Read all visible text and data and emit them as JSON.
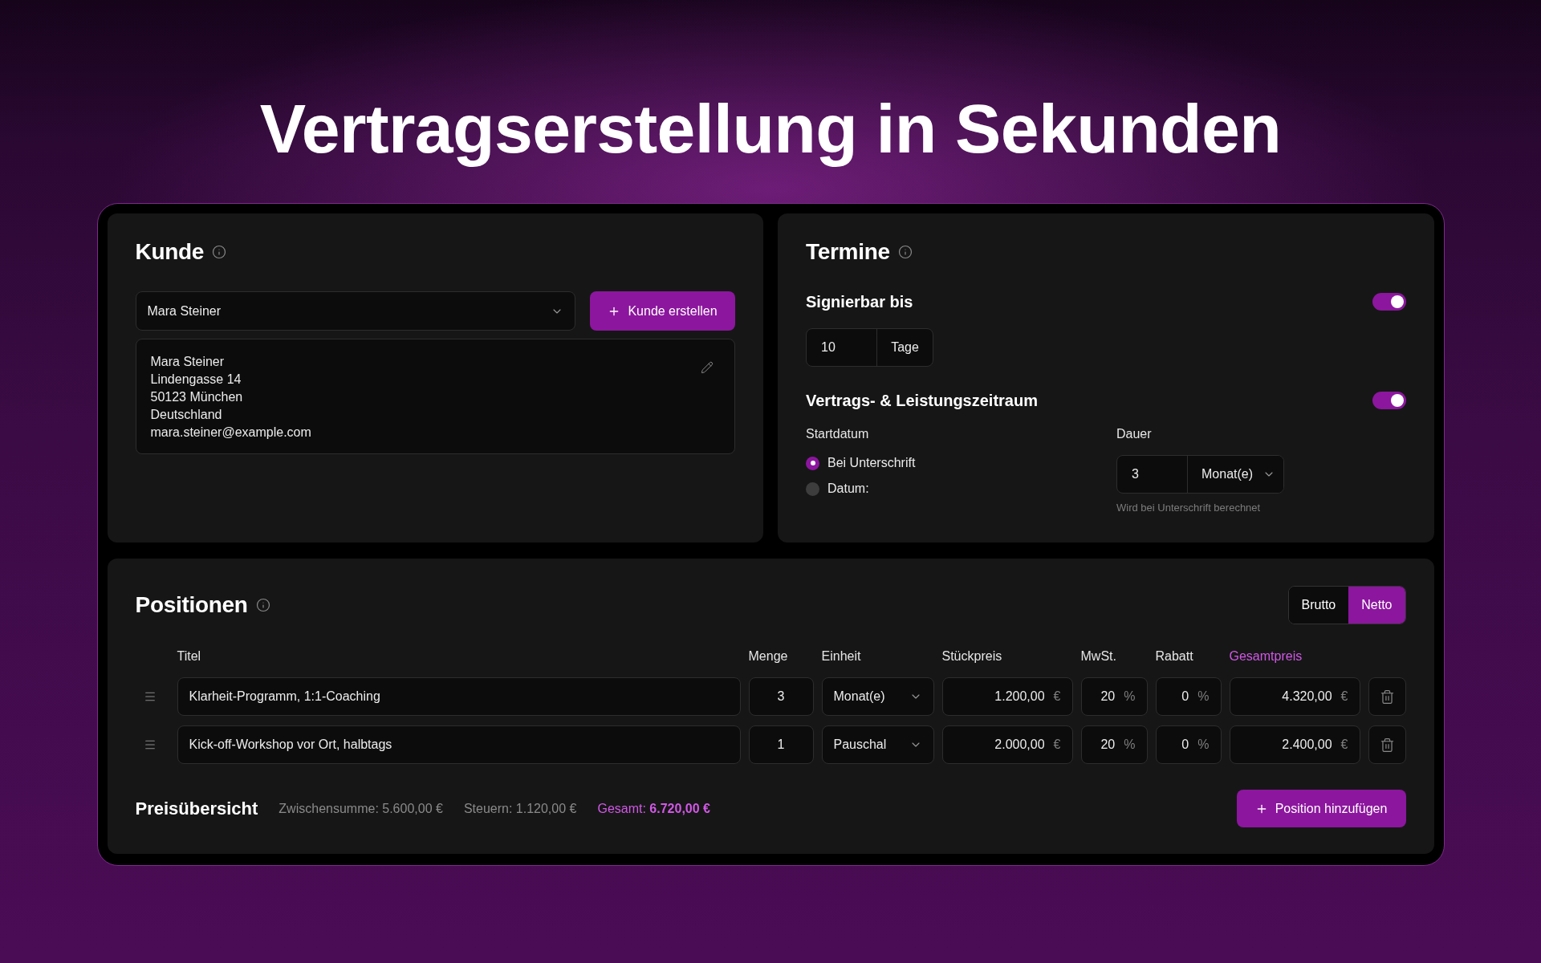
{
  "headline": "Vertragserstellung in Sekunden",
  "customer": {
    "title": "Kunde",
    "select": {
      "value": "Mara Steiner"
    },
    "create_button": "Kunde erstellen",
    "address_lines": [
      "Mara Steiner",
      "Lindengasse 14",
      "50123 München",
      "Deutschland",
      "mara.steiner@example.com"
    ]
  },
  "schedule": {
    "title": "Termine",
    "signable": {
      "label": "Signierbar bis",
      "on": true,
      "value": "10",
      "unit": "Tage"
    },
    "period": {
      "label": "Vertrags- & Leistungszeitraum",
      "on": true,
      "start_label": "Startdatum",
      "start_options": [
        {
          "label": "Bei Unterschrift",
          "selected": true
        },
        {
          "label": "Datum:",
          "selected": false
        }
      ],
      "duration_label": "Dauer",
      "duration_value": "3",
      "duration_unit": "Monat(e)",
      "hint": "Wird bei Unterschrift berechnet"
    }
  },
  "positions": {
    "title": "Positionen",
    "price_modes": [
      {
        "label": "Brutto",
        "selected": false
      },
      {
        "label": "Netto",
        "selected": true
      }
    ],
    "columns": [
      {
        "label": "Titel",
        "highlighted": false
      },
      {
        "label": "Menge",
        "highlighted": false
      },
      {
        "label": "Einheit",
        "highlighted": false
      },
      {
        "label": "Stückpreis",
        "highlighted": false
      },
      {
        "label": "MwSt.",
        "highlighted": false
      },
      {
        "label": "Rabatt",
        "highlighted": false
      },
      {
        "label": "Gesamtpreis",
        "highlighted": true
      }
    ],
    "rows": [
      {
        "title": "Klarheit-Programm, 1:1-Coaching",
        "quantity": "3",
        "unit": "Monat(e)",
        "unit_price": {
          "value": "1.200,00",
          "suffix": "€"
        },
        "vat": {
          "value": "20",
          "suffix": "%"
        },
        "discount": {
          "value": "0",
          "suffix": "%"
        },
        "total": {
          "value": "4.320,00",
          "suffix": "€"
        }
      },
      {
        "title": "Kick-off-Workshop vor Ort, halbtags",
        "quantity": "1",
        "unit": "Pauschal",
        "unit_price": {
          "value": "2.000,00",
          "suffix": "€"
        },
        "vat": {
          "value": "20",
          "suffix": "%"
        },
        "discount": {
          "value": "0",
          "suffix": "%"
        },
        "total": {
          "value": "2.400,00",
          "suffix": "€"
        }
      }
    ],
    "summary": {
      "title": "Preisübersicht",
      "subtotal": "Zwischensumme: 5.600,00 €",
      "taxes": "Steuern: 1.120,00 €",
      "total": "Gesamt: **6.720,00 €**"
    },
    "add_button": "Position hinzufügen"
  }
}
